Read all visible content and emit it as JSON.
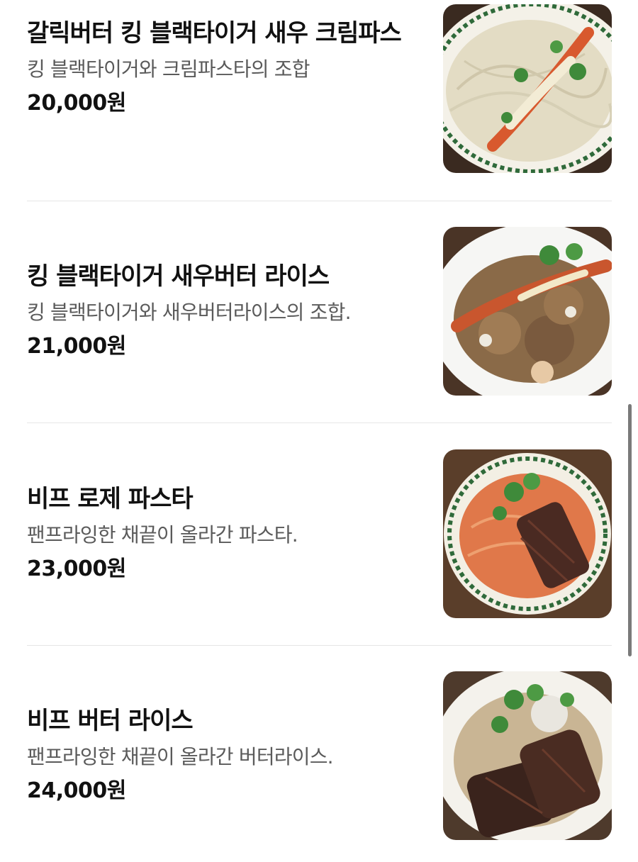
{
  "menu": {
    "items": [
      {
        "name": "갈릭버터 킹 블랙타이거 새우 크림파스",
        "description": "킹 블랙타이거와 크림파스타의 조합",
        "price": "20,000원",
        "image_icon": "shrimp-cream-pasta-photo"
      },
      {
        "name": "킹 블랙타이거 새우버터 라이스",
        "description": "킹 블랙타이거와 새우버터라이스의 조합.",
        "price": "21,000원",
        "image_icon": "shrimp-butter-rice-photo"
      },
      {
        "name": "비프 로제 파스타",
        "description": "팬프라잉한 채끝이 올라간 파스타.",
        "price": "23,000원",
        "image_icon": "beef-rose-pasta-photo"
      },
      {
        "name": "비프 버터 라이스",
        "description": "팬프라잉한 채끝이 올라간 버터라이스.",
        "price": "24,000원",
        "image_icon": "beef-butter-rice-photo"
      }
    ]
  },
  "colors": {
    "text": "#111111",
    "secondary_text": "#5a5a5a",
    "divider": "#e6e6e6",
    "scrollbar": "#7a7a7a"
  }
}
